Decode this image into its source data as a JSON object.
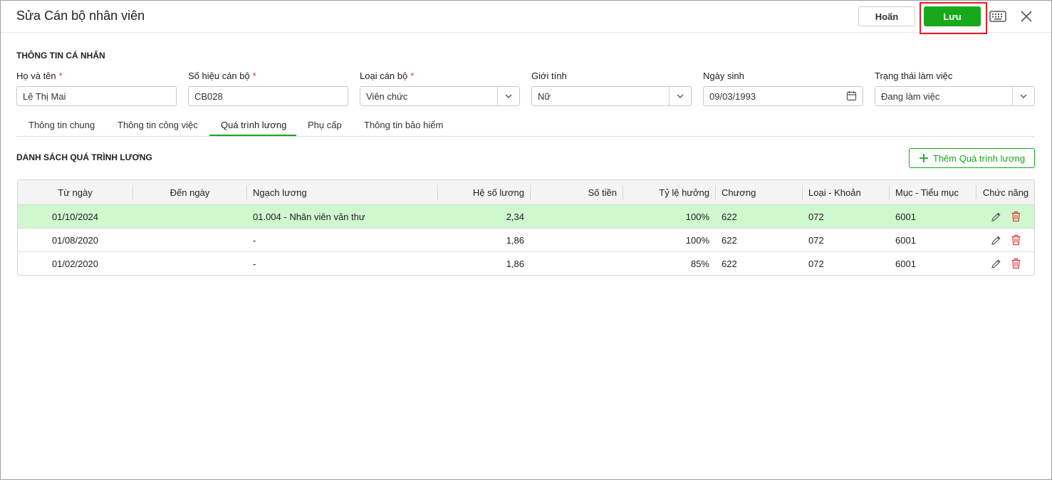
{
  "window": {
    "title": "Sửa Cán bộ nhân viên"
  },
  "header": {
    "cancel_label": "Hoãn",
    "save_label": "Lưu"
  },
  "personal": {
    "section_title": "THÔNG TIN CÁ NHÂN",
    "fields": [
      {
        "label": "Họ và tên",
        "required": "*",
        "value": "Lê Thị Mai"
      },
      {
        "label": "Số hiệu cán bộ",
        "required": "*",
        "value": "CB028"
      },
      {
        "label": "Loại cán bộ",
        "required": "*",
        "value": "Viên chức"
      },
      {
        "label": "Giới tính",
        "value": "Nữ"
      },
      {
        "label": "Ngày sinh",
        "value": "09/03/1993"
      },
      {
        "label": "Trạng thái làm việc",
        "value": "Đang làm việc"
      }
    ]
  },
  "tabs": [
    {
      "label": "Thông tin chung"
    },
    {
      "label": "Thông tin công việc"
    },
    {
      "label": "Quá trình lương",
      "active": true
    },
    {
      "label": "Phụ cấp"
    },
    {
      "label": "Thông tin bảo hiểm"
    }
  ],
  "salary": {
    "list_title": "DANH SÁCH QUÁ TRÌNH LƯƠNG",
    "add_label": "Thêm Quá trình lương",
    "columns": [
      "Từ ngày",
      "Đến ngày",
      "Ngạch lương",
      "Hệ số lương",
      "Số tiền",
      "Tỷ lệ hưởng",
      "Chương",
      "Loại - Khoản",
      "Mục - Tiểu mục",
      "Chức năng"
    ],
    "rows": [
      {
        "from": "01/10/2024",
        "to": "",
        "grade": "01.004 - Nhân viên văn thư",
        "coef": "2,34",
        "amount": "",
        "rate": "100%",
        "chapter": "622",
        "type": "072",
        "item": "6001",
        "selected": true
      },
      {
        "from": "01/08/2020",
        "to": "",
        "grade": "-",
        "coef": "1,86",
        "amount": "",
        "rate": "100%",
        "chapter": "622",
        "type": "072",
        "item": "6001"
      },
      {
        "from": "01/02/2020",
        "to": "",
        "grade": "-",
        "coef": "1,86",
        "amount": "",
        "rate": "85%",
        "chapter": "622",
        "type": "072",
        "item": "6001"
      }
    ]
  },
  "colors": {
    "accent": "#18a81b",
    "danger": "#e53935",
    "selected_row": "#cff8cf",
    "highlight": "#e01f26"
  }
}
